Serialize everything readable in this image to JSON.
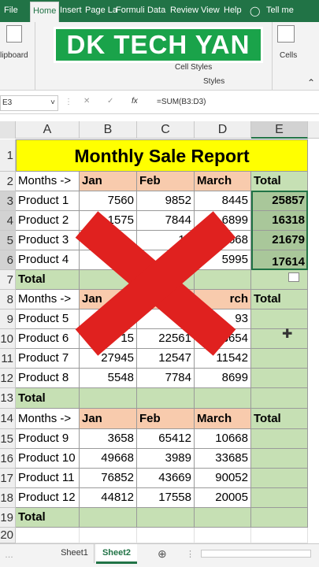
{
  "ribbon": {
    "tabs": [
      "File",
      "Home",
      "Insert",
      "Page La",
      "Formuli",
      "Data",
      "Review",
      "View",
      "Help",
      "Tell me"
    ],
    "clipboard_label": "lipboard",
    "cell_styles_label": "Cell Styles",
    "styles_group": "Styles",
    "cells_label": "Cells"
  },
  "banner": {
    "text": "DK TECH YAN"
  },
  "formula_bar": {
    "name_box": "E3",
    "formula": "=SUM(B3:D3)",
    "fx": "fx"
  },
  "columns": [
    "A",
    "B",
    "C",
    "D",
    "E"
  ],
  "rows": [
    "1",
    "2",
    "3",
    "4",
    "5",
    "6",
    "7",
    "8",
    "9",
    "10",
    "11",
    "12",
    "13",
    "14",
    "15",
    "16",
    "17",
    "18",
    "19",
    "20"
  ],
  "sheet": {
    "title": "Monthly Sale Report",
    "months_label": "Months ->",
    "month_jan": "Jan",
    "month_feb": "Feb",
    "month_mar": "March",
    "total_label": "Total",
    "products": [
      {
        "name": "Product 1",
        "jan": "7560",
        "feb": "9852",
        "mar": "8445",
        "total": "25857"
      },
      {
        "name": "Product 2",
        "jan": "1575",
        "feb": "7844",
        "mar": "6899",
        "total": "16318"
      },
      {
        "name": "Product 3",
        "jan": "",
        "feb": "12",
        "mar": "7668",
        "total": "21679"
      },
      {
        "name": "Product 4",
        "jan": "",
        "feb": "",
        "mar": "5995",
        "total": "17614"
      },
      {
        "name": "Product 5",
        "jan": "",
        "feb": "",
        "mar": "93",
        "total": ""
      },
      {
        "name": "Product 6",
        "jan": "15",
        "feb": "22561",
        "mar": "13654",
        "total": ""
      },
      {
        "name": "Product 7",
        "jan": "27945",
        "feb": "12547",
        "mar": "11542",
        "total": ""
      },
      {
        "name": "Product 8",
        "jan": "5548",
        "feb": "7784",
        "mar": "8699",
        "total": ""
      },
      {
        "name": "Product 9",
        "jan": "3658",
        "feb": "65412",
        "mar": "10668",
        "total": ""
      },
      {
        "name": "Product 10",
        "jan": "49668",
        "feb": "3989",
        "mar": "33685",
        "total": ""
      },
      {
        "name": "Product 11",
        "jan": "76852",
        "feb": "43669",
        "mar": "90052",
        "total": ""
      },
      {
        "name": "Product 12",
        "jan": "44812",
        "feb": "17558",
        "mar": "20005",
        "total": ""
      }
    ],
    "header2_visible": {
      "jan": "Jan",
      "mar": "rch"
    }
  },
  "tabs_bottom": {
    "sheet1": "Sheet1",
    "sheet2": "Sheet2"
  },
  "colors": {
    "accent": "#217346",
    "header": "#f8cbad",
    "total": "#c6e0b4",
    "title": "#ffff00",
    "cross": "#e0211f",
    "banner": "#1aa34a"
  }
}
